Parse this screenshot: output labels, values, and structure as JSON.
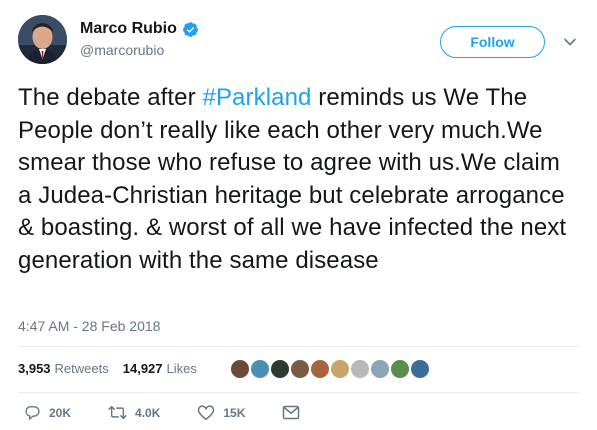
{
  "author": {
    "display_name": "Marco Rubio",
    "handle": "@marcorubio",
    "verified_icon": "verified-badge-icon"
  },
  "header": {
    "follow_label": "Follow",
    "menu_icon": "chevron-down-icon"
  },
  "tweet": {
    "text_before": "The debate after ",
    "hashtag": "#Parkland",
    "text_after": " reminds us We The People don’t really like each other very much.We smear those who refuse to agree with us.We claim a Judea-Christian heritage but celebrate arrogance & boasting. & worst of all we have infected the next generation with the same disease",
    "timestamp": "4:47 AM - 28 Feb 2018"
  },
  "stats": {
    "retweets_count": "3,953",
    "retweets_label": "Retweets",
    "likes_count": "14,927",
    "likes_label": "Likes"
  },
  "likers": {
    "colors": [
      "#6b4a3a",
      "#4a8fb5",
      "#2e3a2f",
      "#7a5a44",
      "#a8643c",
      "#c9a46a",
      "#b9b9b9",
      "#8fa3b6",
      "#5b8e4a",
      "#3a6e9a"
    ]
  },
  "actions": {
    "replies": "20K",
    "retweets": "4.0K",
    "likes": "15K"
  },
  "colors": {
    "accent": "#1da1f2",
    "text": "#14171a",
    "secondary": "#657786",
    "divider": "#e6ecf0"
  }
}
